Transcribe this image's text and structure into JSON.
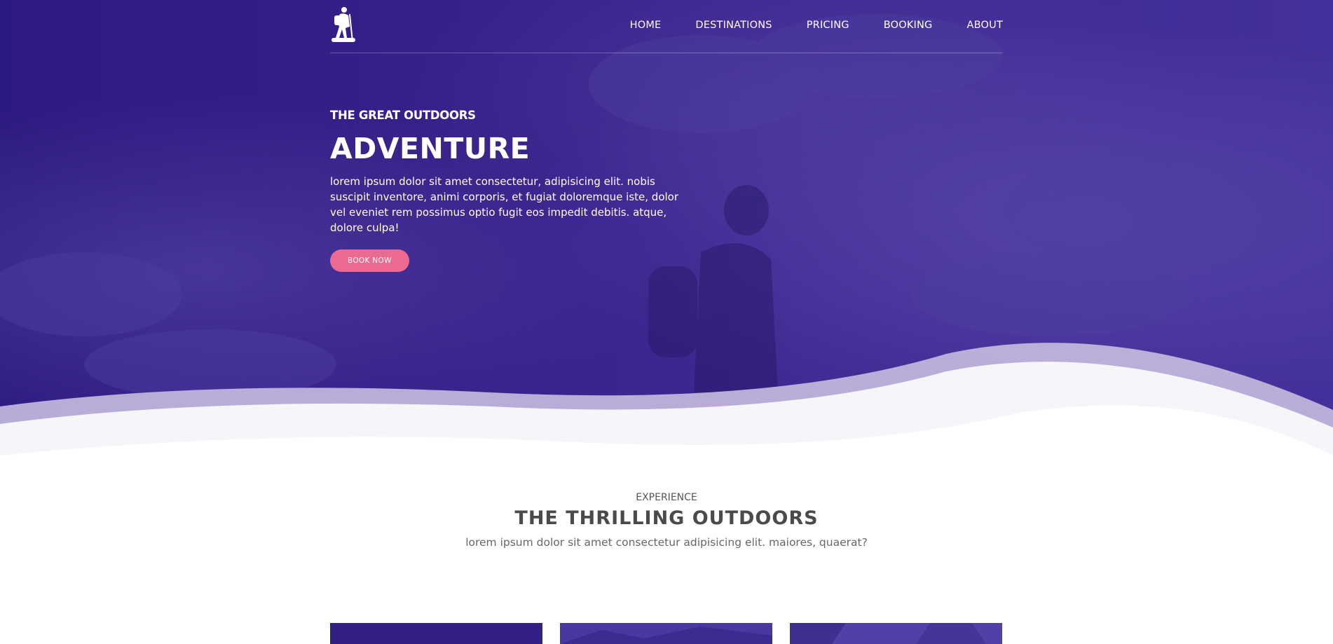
{
  "nav": {
    "logo_icon": "hiker-icon",
    "items": [
      "HOME",
      "DESTINATIONS",
      "PRICING",
      "BOOKING",
      "ABOUT"
    ]
  },
  "hero": {
    "eyebrow": "THE GREAT OUTDOORS",
    "title": "ADVENTURE",
    "description": "lorem ipsum dolor sit amet consectetur, adipisicing elit. nobis suscipit inventore, animi corporis, et fugiat doloremque iste, dolor vel eveniet rem possimus optio fugit eos impedit debitis. atque, dolore culpa!",
    "button_label": "BOOK NOW"
  },
  "experience": {
    "kicker": "EXPERIENCE",
    "heading": "THE THRILLING OUTDOORS",
    "subtitle": "lorem ipsum dolor sit amet consectetur adipisicing elit. maiores, quaerat?"
  },
  "colors": {
    "hero_overlay": "#3a238c",
    "button": "#ec6a92",
    "heading_text": "#4a4a4a"
  }
}
